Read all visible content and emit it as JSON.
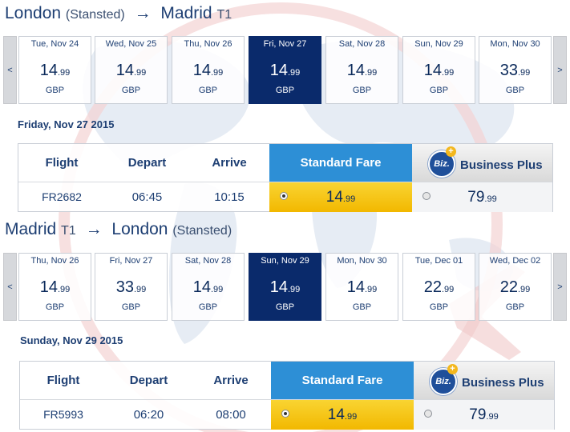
{
  "outbound": {
    "origin": "London",
    "origin_sub": "(Stansted)",
    "destination": "Madrid",
    "destination_sub": "T1",
    "arrow": "→",
    "prev": "<",
    "next": ">",
    "days": [
      {
        "date": "Tue, Nov 24",
        "price": "14",
        "cents": ".99",
        "currency": "GBP"
      },
      {
        "date": "Wed, Nov 25",
        "price": "14",
        "cents": ".99",
        "currency": "GBP"
      },
      {
        "date": "Thu, Nov 26",
        "price": "14",
        "cents": ".99",
        "currency": "GBP"
      },
      {
        "date": "Fri, Nov 27",
        "price": "14",
        "cents": ".99",
        "currency": "GBP"
      },
      {
        "date": "Sat, Nov 28",
        "price": "14",
        "cents": ".99",
        "currency": "GBP"
      },
      {
        "date": "Sun, Nov 29",
        "price": "14",
        "cents": ".99",
        "currency": "GBP"
      },
      {
        "date": "Mon, Nov 30",
        "price": "33",
        "cents": ".99",
        "currency": "GBP"
      }
    ],
    "selected_index": 3,
    "selected_date_heading": "Friday, Nov 27 2015",
    "table": {
      "headers": {
        "flight": "Flight",
        "depart": "Depart",
        "arrive": "Arrive",
        "standard": "Standard Fare",
        "business": "Business Plus",
        "biz_badge": "Biz.",
        "biz_plus": "+"
      },
      "row": {
        "flight": "FR2682",
        "depart": "06:45",
        "arrive": "10:15",
        "standard_price": "14",
        "standard_cents": ".99",
        "business_price": "79",
        "business_cents": ".99"
      }
    }
  },
  "return": {
    "origin": "Madrid",
    "origin_sub": "T1",
    "destination": "London",
    "destination_sub": "(Stansted)",
    "arrow": "→",
    "prev": "<",
    "next": ">",
    "days": [
      {
        "date": "Thu, Nov 26",
        "price": "14",
        "cents": ".99",
        "currency": "GBP"
      },
      {
        "date": "Fri, Nov 27",
        "price": "33",
        "cents": ".99",
        "currency": "GBP"
      },
      {
        "date": "Sat, Nov 28",
        "price": "14",
        "cents": ".99",
        "currency": "GBP"
      },
      {
        "date": "Sun, Nov 29",
        "price": "14",
        "cents": ".99",
        "currency": "GBP"
      },
      {
        "date": "Mon, Nov 30",
        "price": "14",
        "cents": ".99",
        "currency": "GBP"
      },
      {
        "date": "Tue, Dec 01",
        "price": "22",
        "cents": ".99",
        "currency": "GBP"
      },
      {
        "date": "Wed, Dec 02",
        "price": "22",
        "cents": ".99",
        "currency": "GBP"
      }
    ],
    "selected_index": 3,
    "selected_date_heading": "Sunday, Nov 29 2015",
    "table": {
      "headers": {
        "flight": "Flight",
        "depart": "Depart",
        "arrive": "Arrive",
        "standard": "Standard Fare",
        "business": "Business Plus",
        "biz_badge": "Biz.",
        "biz_plus": "+"
      },
      "row": {
        "flight": "FR5993",
        "depart": "06:20",
        "arrive": "08:00",
        "standard_price": "14",
        "standard_cents": ".99",
        "business_price": "79",
        "business_cents": ".99"
      }
    }
  },
  "colors": {
    "selected_day": "#0a2a6b",
    "standard_header": "#2d8fd6",
    "standard_cell": "#f2b800",
    "text": "#1e3f73"
  }
}
